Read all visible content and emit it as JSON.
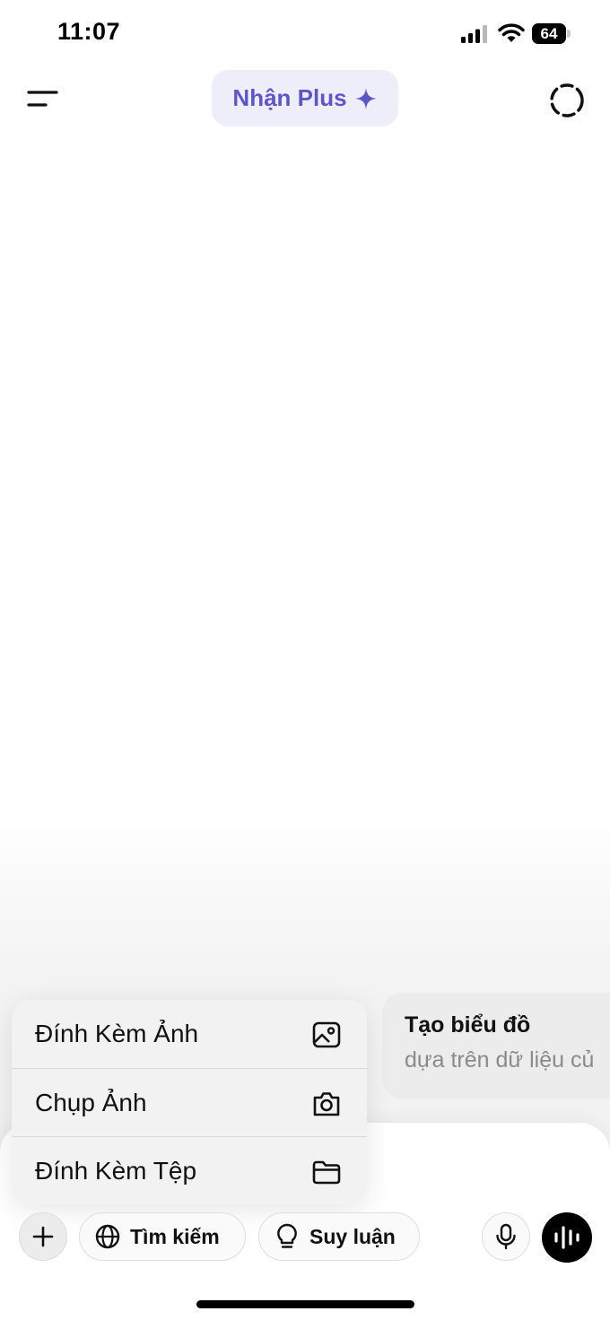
{
  "status_bar": {
    "time": "11:07",
    "battery_level": "64",
    "icons": [
      "signal-icon",
      "wifi-icon",
      "battery-icon"
    ]
  },
  "header": {
    "menu_icon": "menu-icon",
    "upgrade_label": "Nhận Plus",
    "upgrade_icon": "sparkle-icon",
    "right_icon": "temporary-chat-icon"
  },
  "attach_menu": {
    "items": [
      {
        "label": "Đính Kèm Ảnh",
        "icon": "image-icon"
      },
      {
        "label": "Chụp Ảnh",
        "icon": "camera-icon"
      },
      {
        "label": "Đính Kèm Tệp",
        "icon": "folder-icon"
      }
    ]
  },
  "suggestion": {
    "title": "Tạo biểu đồ",
    "subtitle": "dựa trên dữ liệu củ"
  },
  "toolbar": {
    "add_icon": "plus-icon",
    "search_label": "Tìm kiếm",
    "search_icon": "globe-icon",
    "reason_label": "Suy luận",
    "reason_icon": "lightbulb-icon",
    "mic_icon": "microphone-icon",
    "voice_icon": "voice-waveform-icon"
  },
  "colors": {
    "accent": "#5c56c9",
    "pill_bg": "#eeeefb",
    "menu_bg": "#f2f2f2",
    "voice_button": "#000000"
  }
}
